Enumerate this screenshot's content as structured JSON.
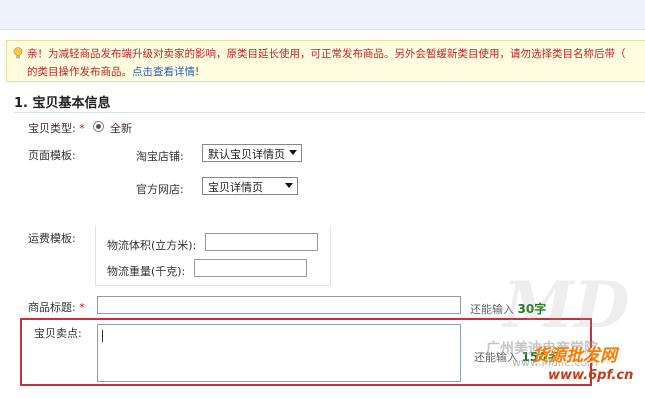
{
  "notice": {
    "line1": "亲！为减轻商品发布端升级对卖家的影响，原类目延长使用，可正常发布商品。另外会暂缓新类目使用，请勿选择类目名称后带（",
    "line2_text": "的类目操作发布商品。",
    "line2_link": "点击查看详情",
    "line2_end": "!",
    "icon": "lightbulb-icon"
  },
  "section": {
    "title": "1. 宝贝基本信息"
  },
  "item_type": {
    "label": "宝贝类型:",
    "required": "*",
    "option_label": "全新"
  },
  "page_template": {
    "label": "页面模板:",
    "taobao_label": "淘宝店铺:",
    "taobao_value": "默认宝贝详情页",
    "official_label": "官方网店:",
    "official_value": "宝贝详情页"
  },
  "shipping": {
    "label": "运费模板:",
    "volume_label": "物流体积(立方米):",
    "weight_label": "物流重量(千克):"
  },
  "title_field": {
    "label": "商品标题:",
    "required": "*",
    "hint_prefix": "还能输入",
    "hint_count": "30字"
  },
  "selling_point": {
    "label": "宝贝卖点:",
    "hint_prefix": "还能输入",
    "hint_count": "150字"
  },
  "watermarks": {
    "logo": "MD",
    "cn_text": "广州美迪电商学院",
    "url": "www.Mdlie.com",
    "brand": "货源批发网",
    "site": "www.6pf.cn"
  },
  "colors": {
    "notice_text": "#c0262b",
    "link": "#2d63b7",
    "hint_count": "#1d7a21",
    "highlight_border": "#c8303a"
  }
}
